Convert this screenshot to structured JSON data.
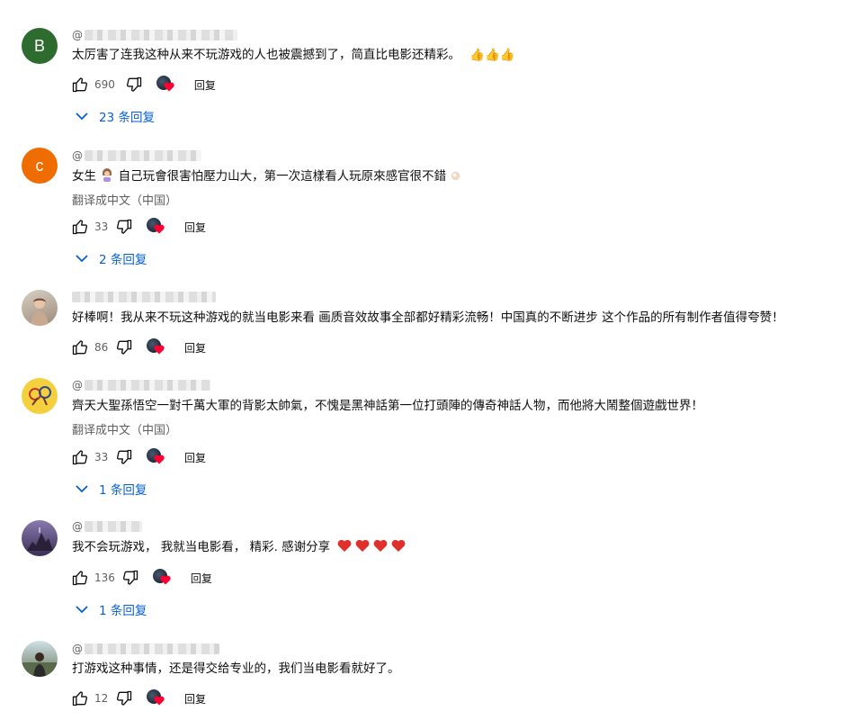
{
  "common": {
    "reply_label": "回复",
    "translate_label": "翻译成中文（中国）",
    "at_sign": "@"
  },
  "comments": [
    {
      "avatar_letter": "B",
      "avatar_color": "#2e6b2e",
      "text": "太厉害了连我这种从来不玩游戏的人也被震撼到了，简直比电影还精彩。",
      "emoji_suffix": "👍👍👍",
      "likes": "690",
      "replies": "23 条回复"
    },
    {
      "avatar_letter": "c",
      "avatar_color": "#ef6c00",
      "text": "女生",
      "text_b": "自己玩會很害怕壓力山大，第一次這樣看人玩原來感官很不錯",
      "likes": "33",
      "replies": "2 条回复"
    },
    {
      "avatar_letter": "",
      "avatar_color": "#b9a89a",
      "text": "好棒啊！我从来不玩这种游戏的就当电影来看 画质音效故事全部都好精彩流畅！中国真的不断进步 这个作品的所有制作者值得夸赞！",
      "likes": "86"
    },
    {
      "avatar_letter": "",
      "avatar_color": "#f4d03f",
      "text": "齊天大聖孫悟空一對千萬大軍的背影太帥氣，不愧是黑神話第一位打頭陣的傳奇神話人物，而他將大鬧整個遊戲世界！",
      "likes": "33",
      "replies": "1 条回复"
    },
    {
      "avatar_letter": "",
      "avatar_color": "#5a4a7a",
      "text": "我不会玩游戏， 我就当电影看， 精彩. 感谢分享",
      "likes": "136",
      "replies": "1 条回复"
    },
    {
      "avatar_letter": "",
      "avatar_color": "#7a8a6a",
      "text": "打游戏这种事情，还是得交给专业的，我们当电影看就好了。",
      "likes": "12"
    }
  ]
}
